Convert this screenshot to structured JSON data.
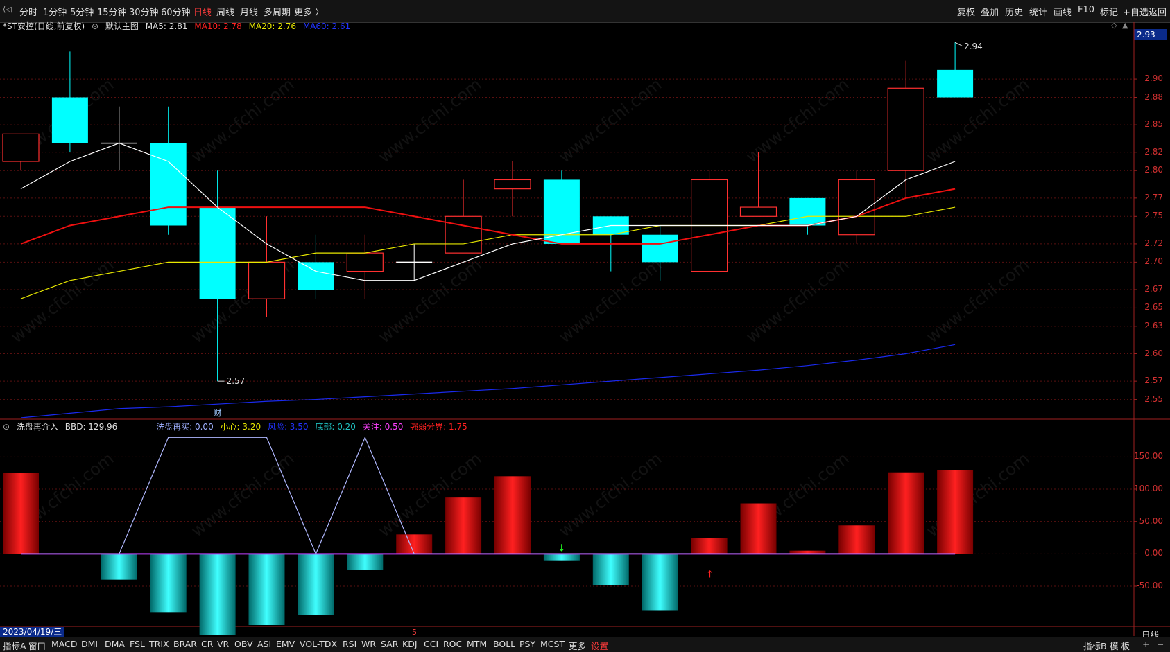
{
  "toolbar": {
    "timeframes": [
      "分时",
      "1分钟",
      "5分钟",
      "15分钟",
      "30分钟",
      "60分钟",
      "日线",
      "周线",
      "月线",
      "多周期",
      "更多 〉"
    ],
    "active_timeframe": "日线",
    "right_tools": [
      "复权",
      "叠加",
      "历史",
      "统计",
      "画线",
      "F10",
      "标记",
      "+自选",
      "返回"
    ]
  },
  "main_chart": {
    "stock_label": "*ST安控(日线,前复权)",
    "template": "默认主图",
    "ma5_label": "MA5: 2.81",
    "ma10_label": "MA10: 2.78",
    "ma20_label": "MA20: 2.76",
    "ma60_label": "MA60: 2.61",
    "price_tag": "2.93",
    "high_label": "2.94",
    "low_label": "2.57",
    "y_labels": [
      "2.90",
      "2.88",
      "2.85",
      "2.82",
      "2.80",
      "2.77",
      "2.75",
      "2.72",
      "2.70",
      "2.67",
      "2.65",
      "2.63",
      "2.60",
      "2.57",
      "2.55"
    ],
    "news_marker": "财"
  },
  "indicator": {
    "name": "洗盘再介入",
    "bbd_label": "BBD: 129.96",
    "xipan_label": "洗盘再买: 0.00",
    "xiaoxin_label": "小心: 3.20",
    "fengxian_label": "风险: 3.50",
    "dibu_label": "底部: 0.20",
    "guanzhu_label": "关注: 0.50",
    "qiangruo_label": "强弱分界: 1.75",
    "y_labels": [
      "150.00",
      "100.00",
      "50.00",
      "0.00",
      "-50.00"
    ]
  },
  "status": {
    "date": "2023/04/19/三",
    "period": "日线",
    "cursor_mark": "5"
  },
  "bottom_tabs": [
    "指标A",
    "窗口",
    "MACD",
    "DMI",
    "DMA",
    "FSL",
    "TRIX",
    "BRAR",
    "CR",
    "VR",
    "OBV",
    "ASI",
    "EMV",
    "VOL-TDX",
    "RSI",
    "WR",
    "SAR",
    "KDJ",
    "CCI",
    "ROC",
    "MTM",
    "BOLL",
    "PSY",
    "MCST",
    "更多",
    "设置"
  ],
  "bottom_right": [
    "指标B",
    "模 板",
    "+",
    "−"
  ],
  "watermark": "www.cfchi.com",
  "chart_data": {
    "type": "candlestick",
    "candles": [
      {
        "o": 2.81,
        "h": 2.82,
        "l": 2.8,
        "c": 2.84,
        "dir": "up"
      },
      {
        "o": 2.83,
        "h": 2.93,
        "l": 2.82,
        "c": 2.88,
        "dir": "down"
      },
      {
        "o": 2.83,
        "h": 2.87,
        "l": 2.8,
        "c": 2.83,
        "dir": "flat"
      },
      {
        "o": 2.83,
        "h": 2.87,
        "l": 2.73,
        "c": 2.74,
        "dir": "down"
      },
      {
        "o": 2.76,
        "h": 2.8,
        "l": 2.57,
        "c": 2.66,
        "dir": "down"
      },
      {
        "o": 2.66,
        "h": 2.75,
        "l": 2.64,
        "c": 2.7,
        "dir": "up"
      },
      {
        "o": 2.7,
        "h": 2.73,
        "l": 2.66,
        "c": 2.67,
        "dir": "down"
      },
      {
        "o": 2.69,
        "h": 2.73,
        "l": 2.66,
        "c": 2.71,
        "dir": "up"
      },
      {
        "o": 2.7,
        "h": 2.72,
        "l": 2.68,
        "c": 2.7,
        "dir": "flat"
      },
      {
        "o": 2.71,
        "h": 2.79,
        "l": 2.71,
        "c": 2.75,
        "dir": "up"
      },
      {
        "o": 2.78,
        "h": 2.81,
        "l": 2.75,
        "c": 2.79,
        "dir": "up"
      },
      {
        "o": 2.79,
        "h": 2.8,
        "l": 2.72,
        "c": 2.72,
        "dir": "down"
      },
      {
        "o": 2.75,
        "h": 2.75,
        "l": 2.69,
        "c": 2.73,
        "dir": "down"
      },
      {
        "o": 2.73,
        "h": 2.74,
        "l": 2.68,
        "c": 2.7,
        "dir": "down"
      },
      {
        "o": 2.69,
        "h": 2.8,
        "l": 2.69,
        "c": 2.79,
        "dir": "up"
      },
      {
        "o": 2.75,
        "h": 2.82,
        "l": 2.75,
        "c": 2.76,
        "dir": "up"
      },
      {
        "o": 2.77,
        "h": 2.77,
        "l": 2.73,
        "c": 2.74,
        "dir": "down"
      },
      {
        "o": 2.73,
        "h": 2.8,
        "l": 2.72,
        "c": 2.79,
        "dir": "up"
      },
      {
        "o": 2.8,
        "h": 2.92,
        "l": 2.77,
        "c": 2.89,
        "dir": "up"
      },
      {
        "o": 2.91,
        "h": 2.94,
        "l": 2.88,
        "c": 2.88,
        "dir": "down"
      }
    ],
    "ma5": [
      2.78,
      2.81,
      2.83,
      2.81,
      2.76,
      2.72,
      2.69,
      2.68,
      2.68,
      2.7,
      2.72,
      2.73,
      2.74,
      2.74,
      2.74,
      2.74,
      2.74,
      2.75,
      2.79,
      2.81
    ],
    "ma10": [
      2.72,
      2.74,
      2.75,
      2.76,
      2.76,
      2.76,
      2.76,
      2.76,
      2.75,
      2.74,
      2.73,
      2.72,
      2.72,
      2.72,
      2.73,
      2.74,
      2.74,
      2.75,
      2.77,
      2.78
    ],
    "ma20": [
      2.66,
      2.68,
      2.69,
      2.7,
      2.7,
      2.7,
      2.71,
      2.71,
      2.72,
      2.72,
      2.73,
      2.73,
      2.73,
      2.74,
      2.74,
      2.74,
      2.75,
      2.75,
      2.75,
      2.76
    ],
    "ma60": [
      2.53,
      2.535,
      2.54,
      2.542,
      2.545,
      2.548,
      2.55,
      2.553,
      2.556,
      2.559,
      2.562,
      2.566,
      2.57,
      2.574,
      2.578,
      2.582,
      2.587,
      2.593,
      2.6,
      2.61
    ],
    "bbd": [
      125,
      0,
      -40,
      -90,
      -125,
      -110,
      -95,
      -25,
      30,
      87,
      120,
      -10,
      -48,
      -88,
      25,
      78,
      5,
      44,
      126,
      129.96
    ],
    "xipan_line": [
      0,
      0,
      0,
      180,
      180,
      180,
      0,
      180,
      0,
      0,
      0,
      0,
      0,
      0,
      0,
      0,
      0,
      0,
      0,
      0
    ],
    "y_range": [
      2.53,
      2.95
    ],
    "indicator_range": [
      -110,
      190
    ]
  }
}
